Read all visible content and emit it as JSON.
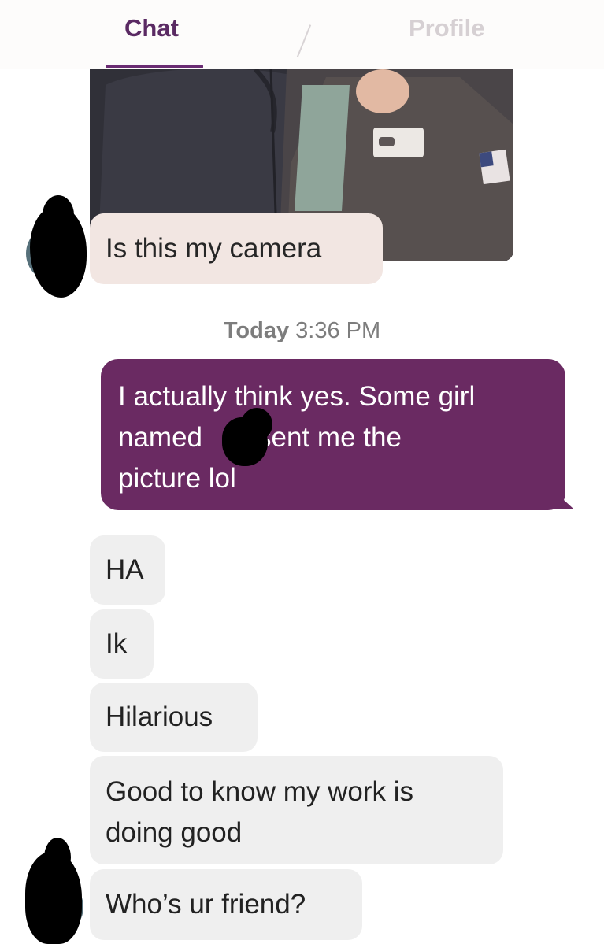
{
  "tabs": {
    "chat": "Chat",
    "profile": "Profile"
  },
  "messages": {
    "camera": "Is this my camera",
    "timestamp_day": "Today",
    "timestamp_time": "3:36 PM",
    "reply_line1": "I actually think yes. Some girl",
    "reply_line2a": "named",
    "reply_line2b": "sent me the",
    "reply_line3": "picture lol",
    "ha": "HA",
    "ik": "Ik",
    "hilarious": "Hilarious",
    "good_line1": "Good to know my work is",
    "good_line2": "doing good",
    "friend": "Who’s ur friend?"
  },
  "colors": {
    "accent": "#6a2c73",
    "outgoing_bubble": "#6a2a62",
    "incoming_bubble": "#efefef",
    "incoming_pink": "#f2e6e2"
  }
}
